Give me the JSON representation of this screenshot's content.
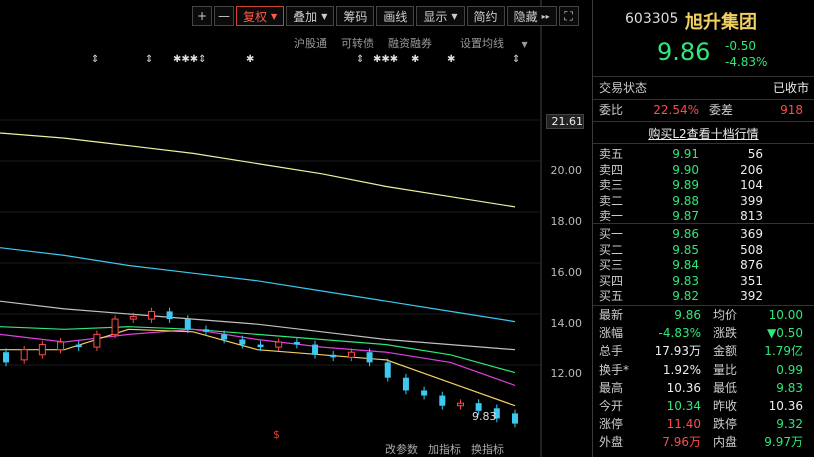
{
  "toolbar": {
    "plus": "+",
    "minus": "—",
    "fuquan": "复权",
    "diejia": "叠加",
    "chouma": "筹码",
    "huaxian": "画线",
    "xianshi": "显示",
    "jiancao": "简约",
    "yincang": "隐藏"
  },
  "subbar": {
    "hgt": "沪股通",
    "kzz": "可转债",
    "rzrq": "融资融券",
    "sz": "设置均线"
  },
  "axis": {
    "y_labels": [
      "21.61",
      "20.00",
      "18.00",
      "16.00",
      "14.00",
      "12.00"
    ]
  },
  "chart_price_tag": "9.83",
  "bottom_bar": [
    "改参数",
    "加指标",
    "换指标"
  ],
  "dollar_marker": "$",
  "chart_data": {
    "type": "line",
    "ylim": [
      9.5,
      21.8
    ],
    "ma_colors": [
      "#f0f0a0",
      "#3cc8f0",
      "#c0c0c0",
      "#2ee87a",
      "#e040e0",
      "#f0d060"
    ],
    "series": [
      {
        "values": [
          21.1,
          20.9,
          20.6,
          20.3,
          19.9,
          19.5,
          19.0,
          18.6,
          18.2
        ]
      },
      {
        "values": [
          16.6,
          16.3,
          15.9,
          15.6,
          15.3,
          14.9,
          14.5,
          14.1,
          13.7
        ]
      },
      {
        "values": [
          14.5,
          14.2,
          14.0,
          13.8,
          13.6,
          13.3,
          13.0,
          12.8,
          12.6
        ]
      },
      {
        "values": [
          13.5,
          13.4,
          13.5,
          13.4,
          13.2,
          13.0,
          12.8,
          12.4,
          11.7
        ]
      },
      {
        "values": [
          13.2,
          12.9,
          13.2,
          13.4,
          13.0,
          12.7,
          12.5,
          12.1,
          11.2
        ]
      },
      {
        "values": [
          12.6,
          12.6,
          13.4,
          13.3,
          12.6,
          12.4,
          12.2,
          11.3,
          10.4
        ]
      }
    ],
    "candles": [
      [
        12.5,
        12.1
      ],
      [
        12.2,
        12.6
      ],
      [
        12.4,
        12.8
      ],
      [
        12.6,
        12.9
      ],
      [
        12.8,
        12.7
      ],
      [
        12.7,
        13.2
      ],
      [
        13.2,
        13.8
      ],
      [
        13.8,
        13.9
      ],
      [
        13.8,
        14.1
      ],
      [
        14.1,
        13.8
      ],
      [
        13.8,
        13.4
      ],
      [
        13.4,
        13.3
      ],
      [
        13.2,
        13.0
      ],
      [
        13.0,
        12.8
      ],
      [
        12.8,
        12.7
      ],
      [
        12.7,
        12.9
      ],
      [
        12.9,
        12.8
      ],
      [
        12.8,
        12.4
      ],
      [
        12.4,
        12.3
      ],
      [
        12.3,
        12.5
      ],
      [
        12.5,
        12.1
      ],
      [
        12.1,
        11.5
      ],
      [
        11.5,
        11.0
      ],
      [
        11.0,
        10.8
      ],
      [
        10.8,
        10.4
      ],
      [
        10.4,
        10.5
      ],
      [
        10.5,
        10.2
      ],
      [
        10.3,
        9.9
      ],
      [
        10.1,
        9.7
      ]
    ]
  },
  "quote": {
    "code": "603305",
    "name": "旭升集团",
    "price": "9.86",
    "change": "-0.50",
    "change_pct": "-4.83%",
    "status_label": "交易状态",
    "status_value": "已收市",
    "weibi_label": "委比",
    "weibi_value": "22.54%",
    "weicha_label": "委差",
    "weicha_value": "918",
    "l2_link": "购买L2查看十档行情",
    "asks": [
      {
        "label": "卖五",
        "price": "9.91",
        "vol": "56"
      },
      {
        "label": "卖四",
        "price": "9.90",
        "vol": "206"
      },
      {
        "label": "卖三",
        "price": "9.89",
        "vol": "104"
      },
      {
        "label": "卖二",
        "price": "9.88",
        "vol": "399"
      },
      {
        "label": "卖一",
        "price": "9.87",
        "vol": "813"
      }
    ],
    "bids": [
      {
        "label": "买一",
        "price": "9.86",
        "vol": "369"
      },
      {
        "label": "买二",
        "price": "9.85",
        "vol": "508"
      },
      {
        "label": "买三",
        "price": "9.84",
        "vol": "876"
      },
      {
        "label": "买四",
        "price": "9.83",
        "vol": "351"
      },
      {
        "label": "买五",
        "price": "9.82",
        "vol": "392"
      }
    ],
    "stats": [
      {
        "l1": "最新",
        "v1": "9.86",
        "c1": "green",
        "l2": "均价",
        "v2": "10.00",
        "c2": "green"
      },
      {
        "l1": "涨幅",
        "v1": "-4.83%",
        "c1": "green",
        "l2": "涨跌",
        "v2": "▼0.50",
        "c2": "green"
      },
      {
        "l1": "总手",
        "v1": "17.93万",
        "c1": "white",
        "l2": "金额",
        "v2": "1.79亿",
        "c2": "green"
      },
      {
        "l1": "换手*",
        "v1": "1.92%",
        "c1": "white",
        "l2": "量比",
        "v2": "0.99",
        "c2": "green"
      },
      {
        "l1": "最高",
        "v1": "10.36",
        "c1": "white",
        "l2": "最低",
        "v2": "9.83",
        "c2": "green"
      },
      {
        "l1": "今开",
        "v1": "10.34",
        "c1": "green",
        "l2": "昨收",
        "v2": "10.36",
        "c2": "white"
      },
      {
        "l1": "涨停",
        "v1": "11.40",
        "c1": "red",
        "l2": "跌停",
        "v2": "9.32",
        "c2": "green"
      },
      {
        "l1": "外盘",
        "v1": "7.96万",
        "c1": "red",
        "l2": "内盘",
        "v2": "9.97万",
        "c2": "green"
      }
    ]
  }
}
